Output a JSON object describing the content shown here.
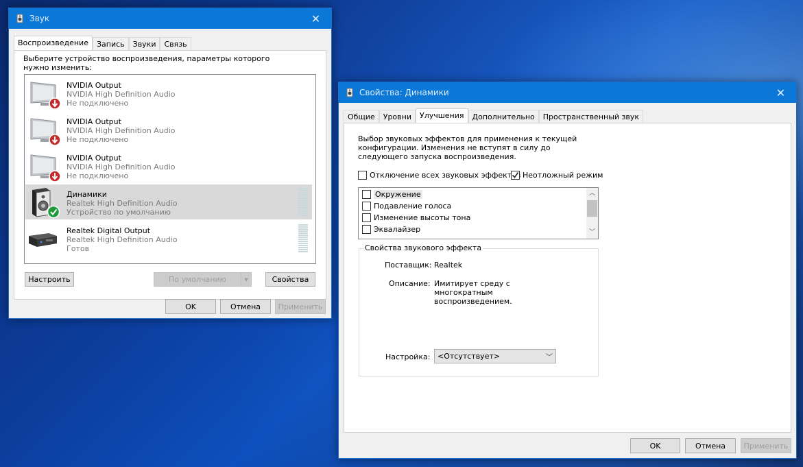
{
  "sound_dialog": {
    "title": "Звук",
    "tabs": [
      "Воспроизведение",
      "Запись",
      "Звуки",
      "Связь"
    ],
    "instruction": "Выберите устройство воспроизведения, параметры которого нужно изменить:",
    "devices": [
      {
        "name": "NVIDIA Output",
        "driver": "NVIDIA High Definition Audio",
        "status": "Не подключено",
        "icon": "monitor-disconnected-icon"
      },
      {
        "name": "NVIDIA Output",
        "driver": "NVIDIA High Definition Audio",
        "status": "Не подключено",
        "icon": "monitor-disconnected-icon"
      },
      {
        "name": "NVIDIA Output",
        "driver": "NVIDIA High Definition Audio",
        "status": "Не подключено",
        "icon": "monitor-disconnected-icon"
      },
      {
        "name": "Динамики",
        "driver": "Realtek High Definition Audio",
        "status": "Устройство по умолчанию",
        "icon": "speaker-default-icon"
      },
      {
        "name": "Realtek Digital Output",
        "driver": "Realtek High Definition Audio",
        "status": "Готов",
        "icon": "digital-output-icon"
      }
    ],
    "configure_label": "Настроить",
    "set_default_label": "По умолчанию",
    "properties_label": "Свойства",
    "ok_label": "OK",
    "cancel_label": "Отмена",
    "apply_label": "Применить"
  },
  "props_dialog": {
    "title": "Свойства: Динамики",
    "tabs": [
      "Общие",
      "Уровни",
      "Улучшения",
      "Дополнительно",
      "Пространственный звук"
    ],
    "description": "Выбор звуковых эффектов для применения к текущей конфигурации. Изменения не вступят в силу до следующего запуска воспроизведения.",
    "disable_all_label": "Отключение всех звуковых эффектов",
    "immediate_mode_label": "Неотложный режим",
    "effects": [
      "Окружение",
      "Подавление голоса",
      "Изменение высоты тона",
      "Эквалайзер"
    ],
    "effect_props_legend": "Свойства звукового эффекта",
    "provider_label": "Поставщик:",
    "provider_value": "Realtek",
    "desc_label": "Описание:",
    "desc_value": "Имитирует среду с многократным воспроизведением.",
    "setting_label": "Настройка:",
    "setting_value": "<Отсутствует>",
    "ok_label": "OK",
    "cancel_label": "Отмена",
    "apply_label": "Применить"
  }
}
